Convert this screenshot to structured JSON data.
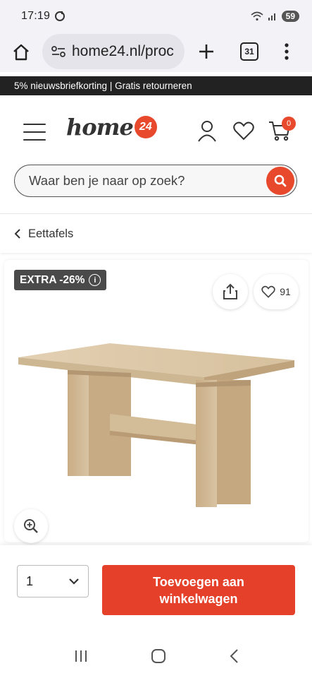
{
  "status": {
    "time": "17:19",
    "battery": "59"
  },
  "browser": {
    "url": "home24.nl/proc",
    "tab_count": "31"
  },
  "promo": {
    "text": "5% nieuwsbriefkorting | Gratis retourneren"
  },
  "header": {
    "logo_text": "home",
    "logo_badge": "24",
    "cart_count": "0",
    "search_placeholder": "Waar ben je naar op zoek?"
  },
  "breadcrumb": {
    "label": "Eettafels"
  },
  "product": {
    "badge": "EXTRA -26%",
    "info": "i",
    "wishlist_count": "91"
  },
  "cart": {
    "quantity": "1",
    "add_label": "Toevoegen aan winkelwagen"
  },
  "colors": {
    "accent": "#e5412a",
    "dark": "#222222",
    "wood": "#d9c3a2"
  }
}
